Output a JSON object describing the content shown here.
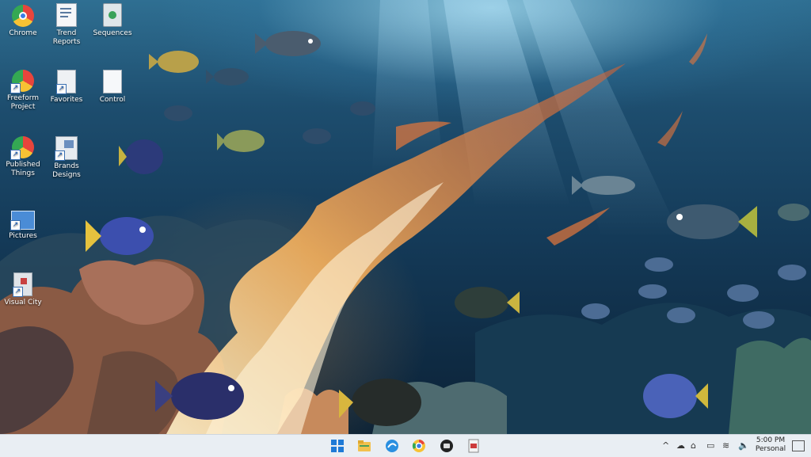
{
  "desktop": {
    "icons": [
      {
        "label": "Chrome",
        "icon": "chrome-icon"
      },
      {
        "label": "Trend Reports",
        "icon": "document-icon"
      },
      {
        "label": "Sequences",
        "icon": "recycle-bin-icon"
      },
      {
        "label": "Freeform Project",
        "icon": "chrome-shortcut-icon"
      },
      {
        "label": "Favorites",
        "icon": "document-shortcut-icon"
      },
      {
        "label": "Control",
        "icon": "blank-document-icon"
      },
      {
        "label": "Published Things",
        "icon": "chrome-shortcut-icon"
      },
      {
        "label": "Brands Designs",
        "icon": "folder-shortcut-icon"
      },
      {
        "label": "Pictures",
        "icon": "picture-shortcut-icon"
      },
      {
        "label": "Visual City",
        "icon": "file-shortcut-icon"
      }
    ]
  },
  "taskbar": {
    "apps": [
      {
        "name": "start-button",
        "icon": "windows-icon",
        "color": "#1f7ad6"
      },
      {
        "name": "file-explorer-taskbar",
        "icon": "folder-icon",
        "color": "#f2c14e"
      },
      {
        "name": "edge-taskbar",
        "icon": "edge-icon",
        "color": "#2a8fe0"
      },
      {
        "name": "chrome-taskbar",
        "icon": "chrome-icon",
        "color": "#e8453c"
      },
      {
        "name": "app-taskbar-dark",
        "icon": "circle-app-icon",
        "color": "#222222"
      },
      {
        "name": "app-taskbar-doc",
        "icon": "document-app-icon",
        "color": "#cc3b3b"
      }
    ],
    "tray": {
      "chevron": "^",
      "clock_time": "5:00 PM",
      "clock_date": "Personal"
    }
  }
}
